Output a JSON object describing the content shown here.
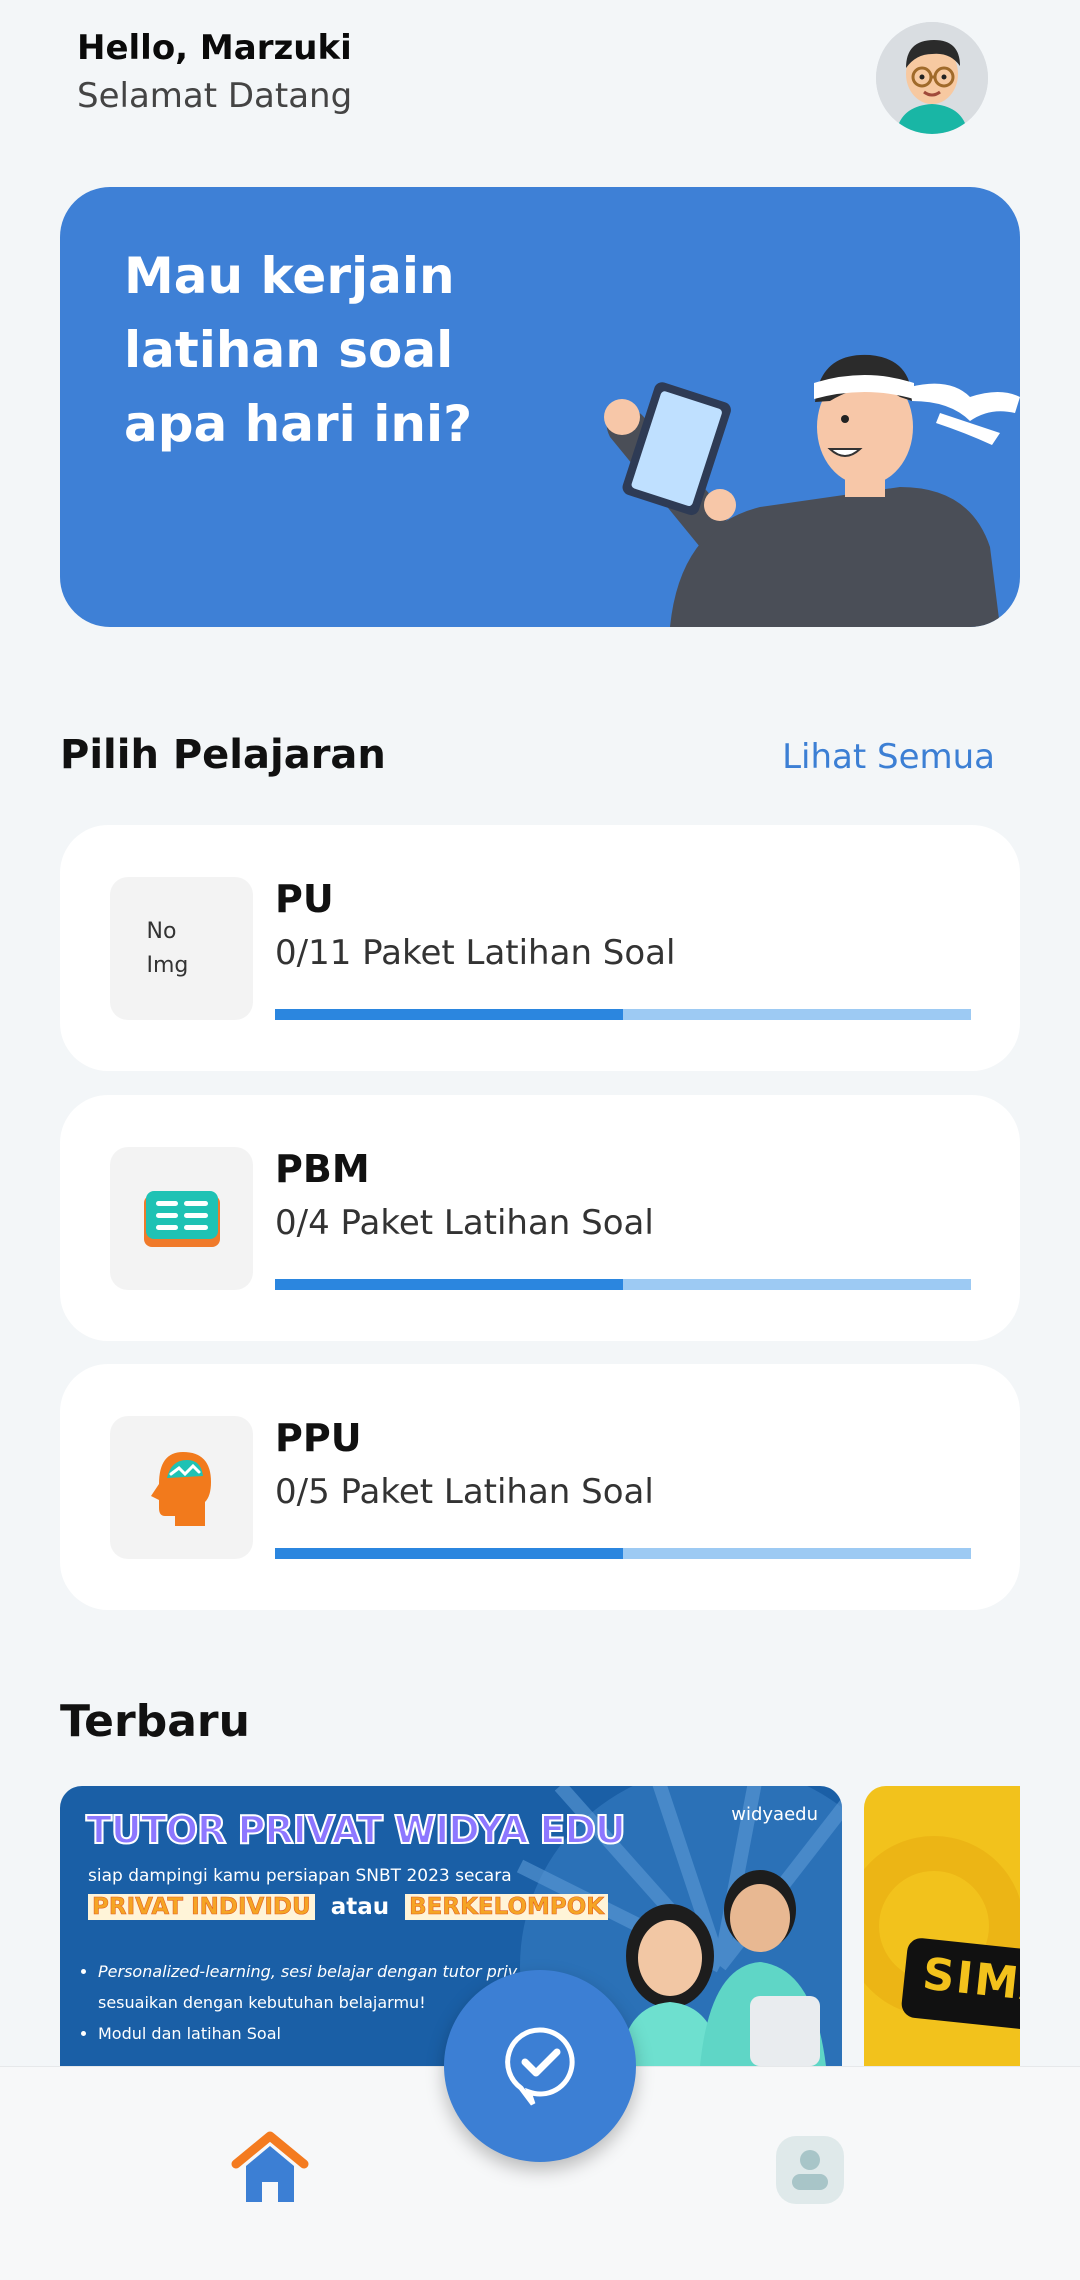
{
  "header": {
    "greeting": "Hello, Marzuki",
    "welcome": "Selamat Datang",
    "avatar_icon": "user-avatar-icon"
  },
  "hero": {
    "lines": [
      "Mau kerjain",
      "latihan soal",
      "apa hari ini?"
    ],
    "illustration": "student-with-tablet-illustration",
    "bg_color": "#3e80d6"
  },
  "subjects_section": {
    "title": "Pilih Pelajaran",
    "see_all": "Lihat Semua",
    "items": [
      {
        "title": "PU",
        "subtitle": "0/11 Paket Latihan Soal",
        "thumb_text": "No Img",
        "icon": "",
        "progress": 0.5
      },
      {
        "title": "PBM",
        "subtitle": "0/4 Paket Latihan Soal",
        "thumb_text": "",
        "icon": "book-icon",
        "progress": 0.5
      },
      {
        "title": "PPU",
        "subtitle": "0/5 Paket Latihan Soal",
        "thumb_text": "",
        "icon": "head-brain-icon",
        "progress": 0.5
      }
    ]
  },
  "latest_section": {
    "title": "Terbaru",
    "banners": [
      {
        "title": "TUTOR PRIVAT WIDYA EDU",
        "brand": "widyaedu",
        "line1": "siap dampingi kamu persiapan SNBT 2023 secara",
        "tag1": "PRIVAT INDIVIDU",
        "connector": "atau",
        "tag2": "BERKELOMPOK",
        "bullets": [
          "Personalized-learning, sesi belajar dengan tutor priv",
          "sesuaikan dengan kebutuhan belajarmu!",
          "Modul dan latihan Soal"
        ]
      },
      {
        "title": "SIMA"
      }
    ]
  },
  "bottom_nav": {
    "home_icon": "home-icon",
    "fab_icon": "check-chat-icon",
    "profile_icon": "profile-icon",
    "accent": "#3c7fd4",
    "home_color": "#f47b20"
  }
}
